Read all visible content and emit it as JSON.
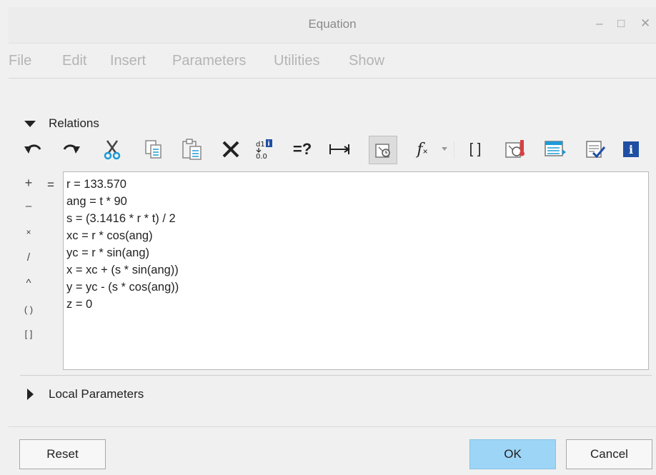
{
  "window": {
    "title": "Equation",
    "controls": [
      "minimize-icon",
      "maximize-icon",
      "close-icon"
    ],
    "minimize_glyph": "–",
    "maximize_glyph": "□",
    "close_glyph": "✕"
  },
  "menu": [
    "File",
    "Edit",
    "Insert",
    "Parameters",
    "Utilities",
    "Show"
  ],
  "relations": {
    "label": "Relations",
    "toolbar": [
      {
        "name": "undo-icon"
      },
      {
        "name": "redo-icon"
      },
      {
        "name": "cut-icon"
      },
      {
        "name": "copy-icon"
      },
      {
        "name": "paste-icon"
      },
      {
        "name": "delete-icon"
      },
      {
        "name": "switch-dimensions-icon",
        "text_top": "d1",
        "text_bottom": "0.0"
      },
      {
        "name": "evaluate-icon",
        "text": "=?"
      },
      {
        "name": "units-sensitivity-icon"
      },
      {
        "name": "verify-relations-icon",
        "pressed": true
      },
      {
        "name": "insert-function-icon",
        "text": "f",
        "sub": "×"
      },
      {
        "name": "function-dropdown-icon"
      },
      {
        "name": "brackets-icon",
        "text": "[ ]"
      },
      {
        "name": "execute-relations-icon"
      },
      {
        "name": "sort-relations-icon"
      },
      {
        "name": "verify-check-icon"
      },
      {
        "name": "info-icon",
        "text": "i"
      }
    ],
    "operators": [
      "+",
      "–",
      "×",
      "/",
      "^",
      "( )",
      "[ ]"
    ],
    "equals": "=",
    "lines": [
      "r = 133.570",
      "ang = t * 90",
      "s = (3.1416 * r * t) / 2",
      "xc = r * cos(ang)",
      "yc = r * sin(ang)",
      "x = xc + (s * sin(ang))",
      "y = yc - (s * cos(ang))",
      "z = 0"
    ]
  },
  "local_parameters": {
    "label": "Local Parameters"
  },
  "buttons": {
    "reset": "Reset",
    "ok": "OK",
    "cancel": "Cancel"
  },
  "colors": {
    "accent": "#9dd5f6",
    "info_blue": "#1f4fa3",
    "red_accent": "#d94040"
  }
}
